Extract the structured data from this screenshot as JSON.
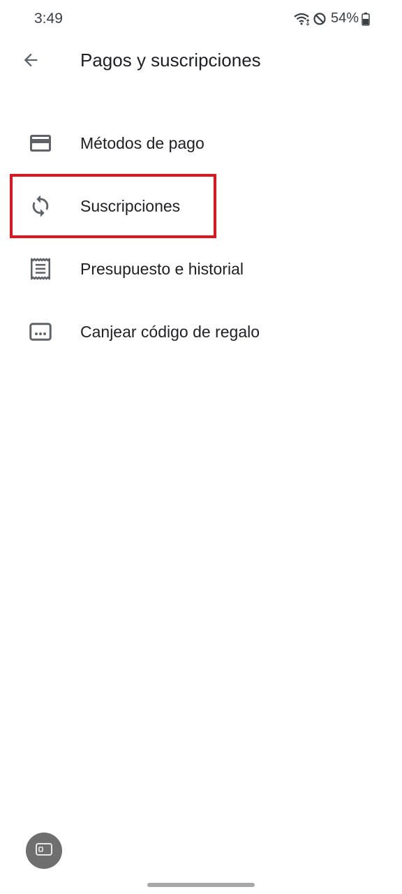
{
  "status_bar": {
    "time": "3:49",
    "battery": "54%",
    "icons": [
      "wifi-icon",
      "do-not-disturb-icon",
      "battery-icon"
    ]
  },
  "app_bar": {
    "title": "Pagos y suscripciones",
    "back_icon": "arrow-back-icon"
  },
  "menu": {
    "items": [
      {
        "label": "Métodos de pago",
        "icon": "credit-card-icon"
      },
      {
        "label": "Suscripciones",
        "icon": "sync-icon",
        "highlighted": true
      },
      {
        "label": "Presupuesto e historial",
        "icon": "receipt-icon"
      },
      {
        "label": "Canjear código de regalo",
        "icon": "gift-card-icon"
      }
    ]
  },
  "colors": {
    "highlight_border": "#e0141e",
    "icon_gray": "#5f6368",
    "text": "#202124"
  },
  "bottom": {
    "floating_icon": "screen-capture-icon"
  }
}
